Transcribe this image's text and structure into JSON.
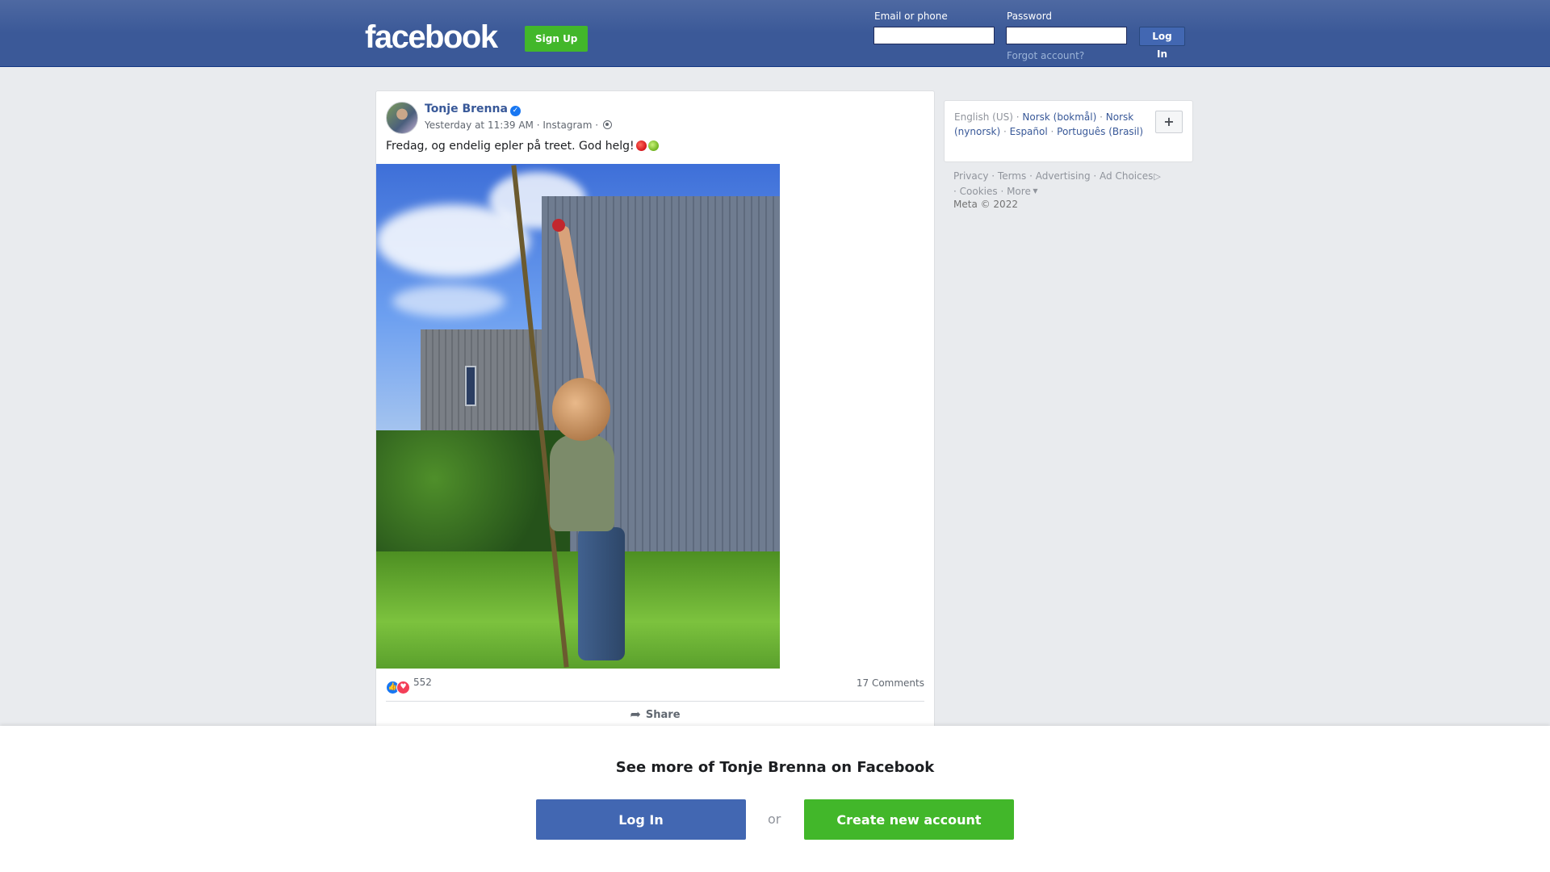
{
  "header": {
    "logo_text": "facebook",
    "signup_label": "Sign Up",
    "email_label": "Email or phone",
    "email_value": "",
    "password_label": "Password",
    "password_value": "",
    "login_label": "Log In",
    "forgot_label": "Forgot account?"
  },
  "post": {
    "author": "Tonje Brenna",
    "verified_icon": "check-badge-icon",
    "timestamp": "Yesterday at 11:39 AM",
    "source": "Instagram",
    "dot_sep": "·",
    "audience_icon": "globe-icon",
    "text": "Fredag, og endelig epler på treet. God helg!",
    "emojis": [
      "red-apple-emoji",
      "green-apple-emoji"
    ],
    "reaction_icons": [
      "like-icon",
      "love-icon"
    ],
    "reaction_count": "552",
    "comments": "17 Comments",
    "share_label": "Share"
  },
  "languages": {
    "current": "English (US)",
    "links": [
      "Norsk (bokmål)",
      "Norsk (nynorsk)",
      "Español",
      "Português (Brasil)"
    ],
    "plus_label": "+"
  },
  "footer": {
    "links": [
      "Privacy",
      "Terms",
      "Advertising",
      "Ad Choices",
      "Cookies",
      "More"
    ],
    "copyright": "Meta © 2022"
  },
  "bottom_bar": {
    "title": "See more of Tonje Brenna on Facebook",
    "login_label": "Log In",
    "or_label": "or",
    "create_label": "Create new account"
  },
  "colors": {
    "brand_blue": "#3b5998",
    "button_blue": "#4267b2",
    "green": "#42b72a",
    "link": "#385898"
  }
}
